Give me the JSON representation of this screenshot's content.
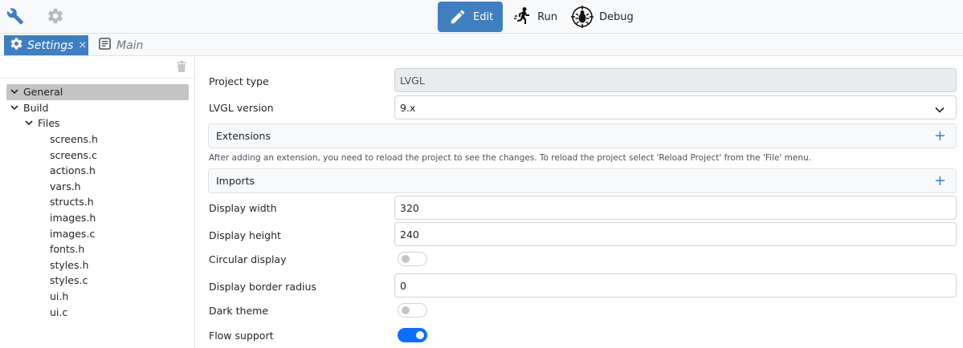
{
  "toolbar": {
    "left_icons": [
      "wrench-icon",
      "gear-icon"
    ],
    "modes": [
      {
        "label": "Edit",
        "icon": "pencil-icon",
        "active": true
      },
      {
        "label": "Run",
        "icon": "runner-icon",
        "active": false
      },
      {
        "label": "Debug",
        "icon": "bug-icon",
        "active": false
      }
    ]
  },
  "tabs": [
    {
      "label": "Settings",
      "icon": "gear-icon",
      "active": true,
      "close": "×"
    },
    {
      "label": "Main",
      "icon": "document-icon",
      "active": false
    }
  ],
  "tree": {
    "items": [
      {
        "label": "General",
        "level": 0,
        "expanded": true,
        "selected": true
      },
      {
        "label": "Build",
        "level": 0,
        "expanded": true
      },
      {
        "label": "Files",
        "level": 1,
        "expanded": true
      },
      {
        "label": "screens.h",
        "level": 2
      },
      {
        "label": "screens.c",
        "level": 2
      },
      {
        "label": "actions.h",
        "level": 2
      },
      {
        "label": "vars.h",
        "level": 2
      },
      {
        "label": "structs.h",
        "level": 2
      },
      {
        "label": "images.h",
        "level": 2
      },
      {
        "label": "images.c",
        "level": 2
      },
      {
        "label": "fonts.h",
        "level": 2
      },
      {
        "label": "styles.h",
        "level": 2
      },
      {
        "label": "styles.c",
        "level": 2
      },
      {
        "label": "ui.h",
        "level": 2
      },
      {
        "label": "ui.c",
        "level": 2
      }
    ]
  },
  "settings": {
    "project_type": {
      "label": "Project type",
      "value": "LVGL"
    },
    "lvgl_version": {
      "label": "LVGL version",
      "value": "9.x"
    },
    "extensions": {
      "label": "Extensions",
      "add": "+"
    },
    "extensions_note": "After adding an extension, you need to reload the project to see the changes. To reload the project select 'Reload Project' from the 'File' menu.",
    "imports": {
      "label": "Imports",
      "add": "+"
    },
    "display_width": {
      "label": "Display width",
      "value": "320"
    },
    "display_height": {
      "label": "Display height",
      "value": "240"
    },
    "circular_display": {
      "label": "Circular display",
      "on": false
    },
    "display_border_radius": {
      "label": "Display border radius",
      "value": "0"
    },
    "dark_theme": {
      "label": "Dark theme",
      "on": false
    },
    "flow_support": {
      "label": "Flow support",
      "on": true
    }
  },
  "colors": {
    "accent": "#3f7fbf",
    "toggle_on": "#0d6efd",
    "selected_row": "#c4c4c4"
  }
}
